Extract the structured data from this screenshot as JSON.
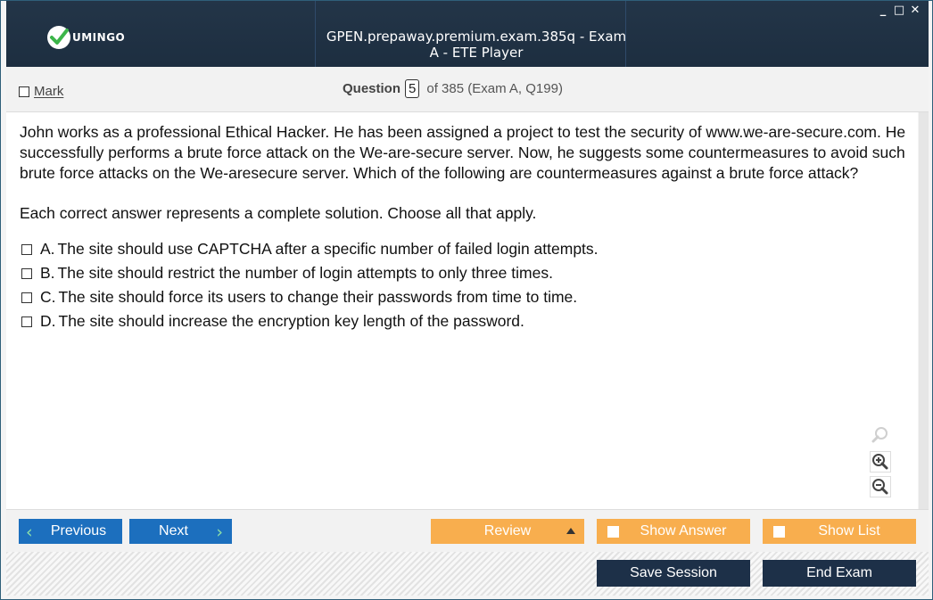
{
  "window": {
    "title": "GPEN.prepaway.premium.exam.385q - Exam A - ETE Player",
    "logo_text": "UMINGO",
    "controls": {
      "minimize": "_",
      "maximize": "□",
      "close": "✕"
    }
  },
  "header": {
    "mark_label": "Mark",
    "question_label": "Question",
    "question_number": "5",
    "question_total": "of 385 (Exam A, Q199)"
  },
  "question": {
    "text": "John works as a professional Ethical Hacker. He has been assigned a project to test the security of www.we-are-secure.com. He successfully performs a brute force attack on the We-are-secure server. Now, he suggests some countermeasures to avoid such brute force attacks on the We-aresecure server. Which of the following are countermeasures against a brute force attack?",
    "instruction": "Each correct answer represents a complete solution. Choose all that apply.",
    "options": [
      {
        "letter": "A.",
        "text": "The site should use CAPTCHA after a specific number of failed login attempts."
      },
      {
        "letter": "B.",
        "text": "The site should restrict the number of login attempts to only three times."
      },
      {
        "letter": "C.",
        "text": "The site should force its users to change their passwords from time to time."
      },
      {
        "letter": "D.",
        "text": "The site should increase the encryption key length of the password."
      }
    ]
  },
  "navigation": {
    "previous_label": "Previous",
    "next_label": "Next",
    "review_label": "Review",
    "show_answer_label": "Show Answer",
    "show_list_label": "Show List"
  },
  "footer": {
    "save_session_label": "Save Session",
    "end_exam_label": "End Exam"
  },
  "icons": [
    "logo-check-icon",
    "search-icon",
    "zoom-in-icon",
    "zoom-out-icon",
    "chevron-left-icon",
    "chevron-right-icon",
    "caret-up-icon"
  ],
  "colors": {
    "titlebar": "#1f3144",
    "nav_blue": "#1c6fbe",
    "nav_orange": "#f8ae4e",
    "footer_dark": "#1d3048",
    "chevron_green": "#8de0a8",
    "logo_green": "#3cb54a"
  }
}
